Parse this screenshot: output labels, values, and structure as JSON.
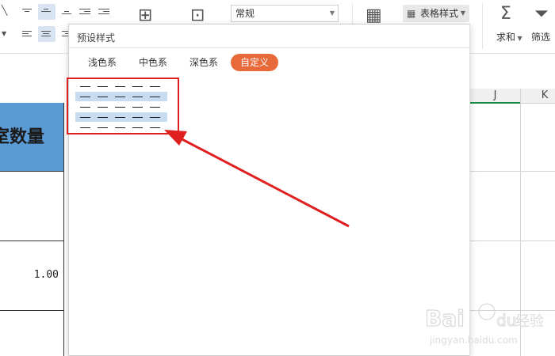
{
  "ribbon": {
    "number_format": "常规",
    "table_style_label": "表格样式",
    "sum_label": "求和",
    "filter_label": "筛选"
  },
  "popup": {
    "title": "预设样式",
    "tabs": [
      {
        "label": "浅色系",
        "active": false
      },
      {
        "label": "中色系",
        "active": false
      },
      {
        "label": "深色系",
        "active": false
      },
      {
        "label": "自定义",
        "active": true
      }
    ]
  },
  "sheet": {
    "columns": [
      "J",
      "K"
    ],
    "header_cell_text": "室数量",
    "cell_value": "1.00"
  },
  "colors": {
    "accent_tab": "#e8693a",
    "header_fill": "#5b9bd5",
    "highlight_box": "#e02020",
    "preset_highlight": "#c7dcf0"
  }
}
